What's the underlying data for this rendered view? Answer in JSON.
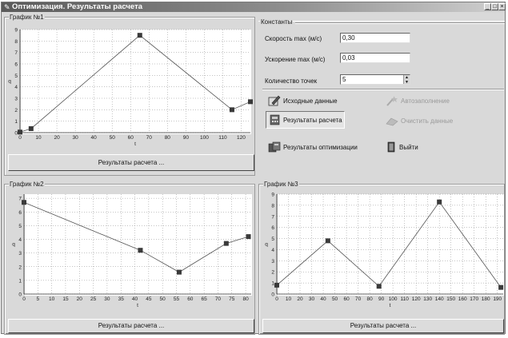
{
  "window": {
    "title": "Оптимизация. Результаты расчета",
    "title_icon": "app-icon",
    "caption_buttons": [
      "_",
      "□",
      "×"
    ]
  },
  "constants": {
    "caption": "Константы",
    "speed_label": "Скорость max (м/с)",
    "speed_value": "0,30",
    "accel_label": "Ускорение max (м/с)",
    "accel_value": "0,03",
    "points_label": "Количество точек",
    "points_value": "5"
  },
  "actions": {
    "source_data": "Исходные данные",
    "autofill": "Автозаполнение",
    "results": "Результаты расчета",
    "clear_data": "Очистить данные",
    "opt_results": "Результаты оптимизации",
    "exit": "Выйти"
  },
  "graphs": [
    {
      "caption": "График №1",
      "button": "Результаты расчета ..."
    },
    {
      "caption": "График №2",
      "button": "Результаты расчета ..."
    },
    {
      "caption": "График №3",
      "button": "Результаты расчета ..."
    }
  ],
  "chart_data": [
    {
      "type": "line",
      "xlabel": "t",
      "ylabel": "q",
      "x": [
        0,
        6,
        65,
        115,
        125
      ],
      "y": [
        0.05,
        0.35,
        8.5,
        2.0,
        2.7
      ],
      "xlim": [
        0,
        125
      ],
      "ylim": [
        0,
        9
      ],
      "xticks": [
        0,
        10,
        20,
        30,
        40,
        50,
        60,
        70,
        80,
        90,
        100,
        110,
        120
      ],
      "yticks": [
        0,
        1,
        2,
        3,
        4,
        5,
        6,
        7,
        8,
        9
      ],
      "grid": true
    },
    {
      "type": "line",
      "xlabel": "t",
      "ylabel": "q",
      "x": [
        0,
        42,
        56,
        73,
        81
      ],
      "y": [
        6.7,
        3.2,
        1.6,
        3.7,
        4.2
      ],
      "xlim": [
        0,
        82
      ],
      "ylim": [
        0,
        7.3
      ],
      "xticks": [
        0,
        5,
        10,
        15,
        20,
        25,
        30,
        35,
        40,
        45,
        50,
        55,
        60,
        65,
        70,
        75,
        80
      ],
      "yticks": [
        0,
        1,
        2,
        3,
        4,
        5,
        6,
        7
      ],
      "grid": true
    },
    {
      "type": "line",
      "xlabel": "t",
      "ylabel": "q",
      "x": [
        0,
        44,
        88,
        140,
        193
      ],
      "y": [
        0.8,
        4.8,
        0.7,
        8.3,
        0.6
      ],
      "xlim": [
        0,
        195
      ],
      "ylim": [
        0,
        9
      ],
      "xticks": [
        0,
        10,
        20,
        30,
        40,
        50,
        60,
        70,
        80,
        90,
        100,
        110,
        120,
        130,
        140,
        150,
        160,
        170,
        180,
        190
      ],
      "yticks": [
        0,
        1,
        2,
        3,
        4,
        5,
        6,
        7,
        8,
        9
      ],
      "grid": true
    }
  ]
}
